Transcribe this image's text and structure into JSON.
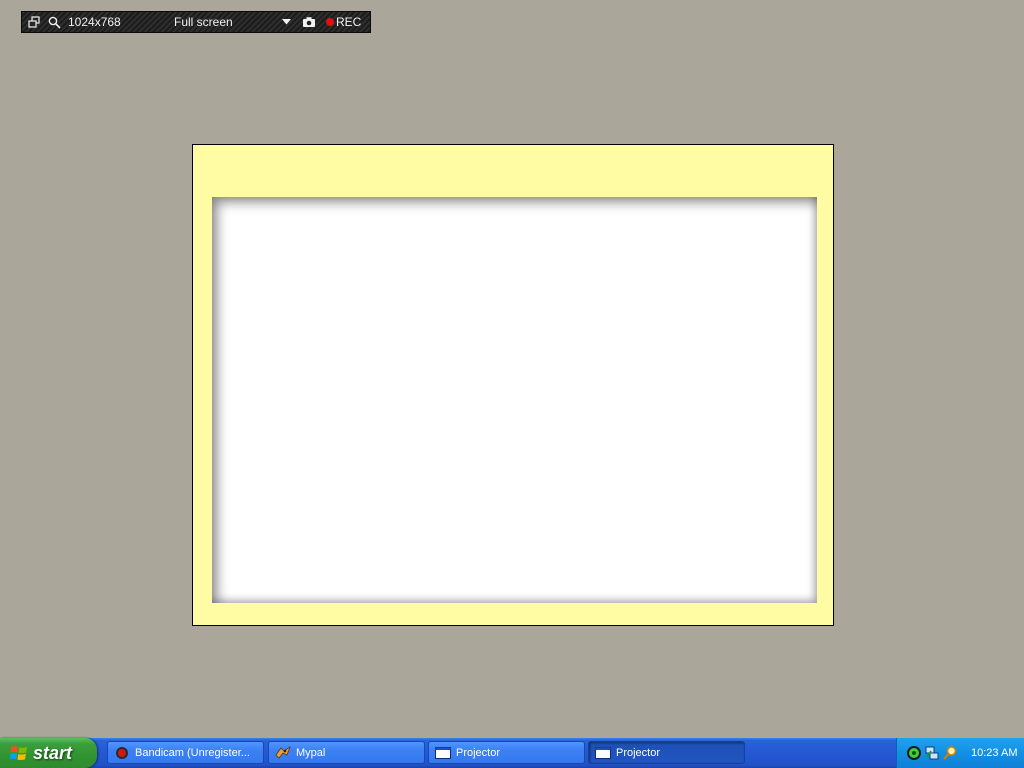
{
  "recorder": {
    "resolution": "1024x768",
    "mode": "Full screen",
    "rec_label": "REC",
    "rec_color": "#e01010",
    "icons": [
      "window-icon",
      "search-icon",
      "dropdown-arrow-icon",
      "camera-icon",
      "record-dot-icon"
    ]
  },
  "projector": {
    "frame_color": "#fffca4",
    "screen_color": "#ffffff"
  },
  "taskbar": {
    "start_label": "start",
    "tasks": [
      {
        "label": "Bandicam (Unregister...",
        "icon": "bandicam-icon",
        "active": false
      },
      {
        "label": "Mypal",
        "icon": "mypal-icon",
        "active": false
      },
      {
        "label": "Projector",
        "icon": "window-icon",
        "active": false
      },
      {
        "label": "Projector",
        "icon": "window-icon",
        "active": true
      }
    ],
    "tray_icons": [
      "green-circle-icon",
      "network-icon",
      "search-icon"
    ],
    "clock": "10:23 AM"
  }
}
